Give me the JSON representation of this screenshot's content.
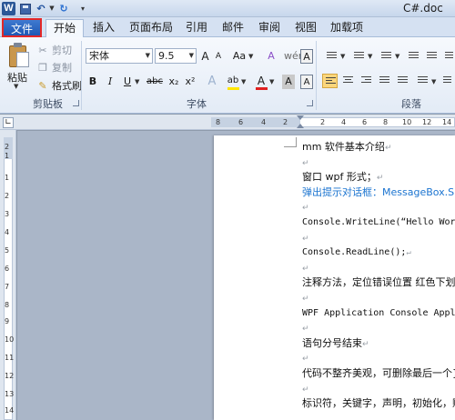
{
  "window": {
    "title": "C#.doc",
    "logo": "W"
  },
  "quick_access": {
    "save_icon": "save-icon",
    "undo_icon": "undo-icon",
    "redo_icon": "redo-icon"
  },
  "tabs": {
    "file": "文件",
    "items": [
      "开始",
      "插入",
      "页面布局",
      "引用",
      "邮件",
      "审阅",
      "视图",
      "加载项"
    ],
    "active": "开始"
  },
  "clipboard": {
    "paste": "粘贴",
    "cut": "剪切",
    "copy": "复制",
    "format_painter": "格式刷",
    "group_label": "剪贴板"
  },
  "font": {
    "name": "宋体",
    "size": "9.5",
    "group_label": "字体",
    "grow": "A",
    "shrink": "A",
    "case": "Aa",
    "clear_format": "A",
    "char_border": "A",
    "bold": "B",
    "italic": "I",
    "underline": "U",
    "strikethrough": "abc",
    "subscript": "x₂",
    "superscript": "x²",
    "text_effect": "A",
    "highlight": "ab",
    "font_color": "A",
    "char_shading": "A",
    "phonetic": "wén",
    "highlight_color": "#ffe600",
    "font_color_value": "#e02020"
  },
  "paragraph": {
    "group_label": "段落"
  },
  "ruler": {
    "h_numbers": [
      "8",
      "6",
      "4",
      "2",
      "2",
      "4",
      "6",
      "8",
      "10",
      "12",
      "14"
    ],
    "v_numbers": [
      "2",
      "1",
      "1",
      "2",
      "3",
      "4",
      "5",
      "6",
      "7",
      "8",
      "9",
      "10",
      "11",
      "12",
      "13",
      "14"
    ]
  },
  "document": {
    "lines": [
      {
        "text": "mm 软件基本介绍",
        "style": "normal"
      },
      {
        "text": "",
        "style": "normal"
      },
      {
        "text": "窗口 wpf 形式；",
        "style": "normal"
      },
      {
        "text": "弹出提示对话框：MessageBox.Show(",
        "style": "blue"
      },
      {
        "text": "",
        "style": "normal"
      },
      {
        "text": "Console.WriteLine(“Hello World”",
        "style": "code"
      },
      {
        "text": "",
        "style": "normal"
      },
      {
        "text": "Console.ReadLine();",
        "style": "code"
      },
      {
        "text": "",
        "style": "normal"
      },
      {
        "text": "注释方法，定位错误位置  红色下划",
        "style": "normal"
      },
      {
        "text": "",
        "style": "normal"
      },
      {
        "text": "WPF Application   Console Applic",
        "style": "code"
      },
      {
        "text": "",
        "style": "normal"
      },
      {
        "text": "语句分号结束",
        "style": "normal"
      },
      {
        "text": "",
        "style": "normal"
      },
      {
        "text": "代码不整齐美观，可删除最后一个}",
        "style": "normal"
      },
      {
        "text": "",
        "style": "normal"
      },
      {
        "text": "标识符，关键字，声明，初始化，赋",
        "style": "normal"
      }
    ],
    "paragraph_mark": "↵"
  }
}
